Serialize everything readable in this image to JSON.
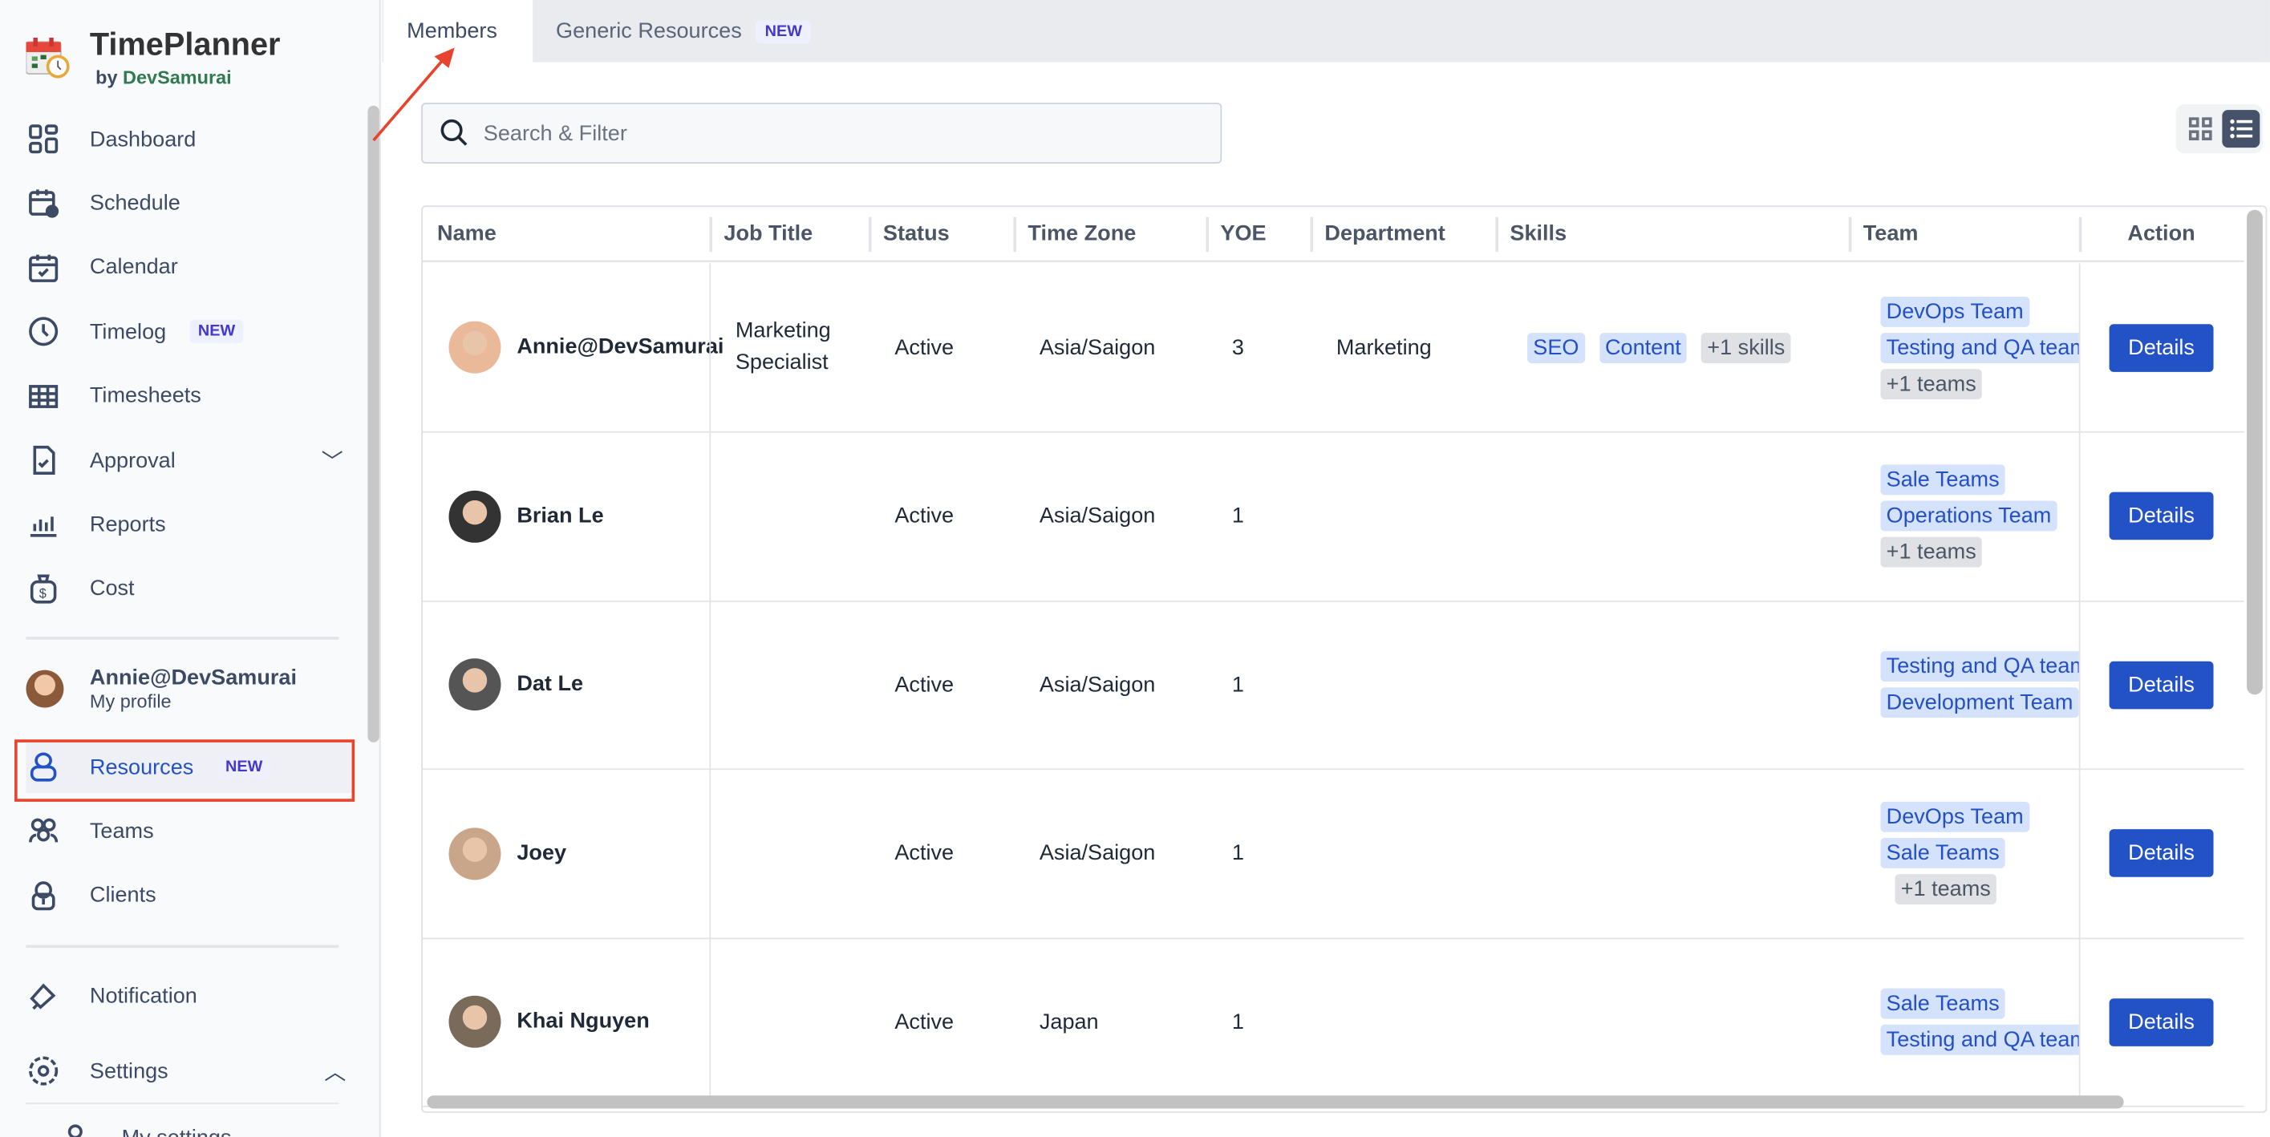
{
  "app": {
    "title": "TimePlanner",
    "by": "by",
    "company": "DevSamurai"
  },
  "sidebar": {
    "items": [
      {
        "label": "Dashboard",
        "icon": "dashboard-icon"
      },
      {
        "label": "Schedule",
        "icon": "schedule-icon"
      },
      {
        "label": "Calendar",
        "icon": "calendar-icon"
      },
      {
        "label": "Timelog",
        "icon": "clock-icon",
        "badge": "NEW"
      },
      {
        "label": "Timesheets",
        "icon": "table-icon"
      },
      {
        "label": "Approval",
        "icon": "approval-icon"
      },
      {
        "label": "Reports",
        "icon": "reports-icon"
      },
      {
        "label": "Cost",
        "icon": "cost-icon"
      }
    ],
    "profile": {
      "name": "Annie@DevSamurai",
      "sub": "My profile"
    },
    "items2": [
      {
        "label": "Resources",
        "icon": "user-icon",
        "badge": "NEW",
        "active": true
      },
      {
        "label": "Teams",
        "icon": "teams-icon"
      },
      {
        "label": "Clients",
        "icon": "clients-icon"
      }
    ],
    "notification": "Notification",
    "settings": "Settings",
    "my_settings": "My settings"
  },
  "tabs": [
    {
      "label": "Members",
      "active": true
    },
    {
      "label": "Generic Resources",
      "badge": "NEW"
    }
  ],
  "search": {
    "placeholder": "Search & Filter"
  },
  "table": {
    "headers": [
      "Name",
      "Job Title",
      "Status",
      "Time Zone",
      "YOE",
      "Department",
      "Skills",
      "Team",
      "Action"
    ],
    "rows": [
      {
        "name": "Annie@DevSamurai",
        "job": "Marketing Specialist",
        "status": "Active",
        "tz": "Asia/Saigon",
        "yoe": "3",
        "dept": "Marketing",
        "skills": [
          "SEO",
          "Content"
        ],
        "skills_more": "+1 skills",
        "teams": [
          "DevOps Team",
          "Testing and QA team"
        ],
        "teams_more": "+1 teams",
        "action": "Details"
      },
      {
        "name": "Brian Le",
        "job": "",
        "status": "Active",
        "tz": "Asia/Saigon",
        "yoe": "1",
        "dept": "",
        "skills": [],
        "teams": [
          "Sale Teams",
          "Operations Team"
        ],
        "teams_more": "+1 teams",
        "action": "Details"
      },
      {
        "name": "Dat Le",
        "job": "",
        "status": "Active",
        "tz": "Asia/Saigon",
        "yoe": "1",
        "dept": "",
        "skills": [],
        "teams": [
          "Testing and QA team",
          "Development Team"
        ],
        "action": "Details"
      },
      {
        "name": "Joey",
        "job": "",
        "status": "Active",
        "tz": "Asia/Saigon",
        "yoe": "1",
        "dept": "",
        "skills": [],
        "teams": [
          "DevOps Team",
          "Sale Teams"
        ],
        "teams_inline_more": "+1 teams",
        "action": "Details"
      },
      {
        "name": "Khai Nguyen",
        "job": "",
        "status": "Active",
        "tz": "Japan",
        "yoe": "1",
        "dept": "",
        "skills": [],
        "teams": [
          "Sale Teams",
          "Testing and QA team"
        ],
        "action": "Details"
      }
    ]
  },
  "colors": {
    "accent": "#2352c6",
    "tag_bg": "#d4e2fc",
    "annotation": "#e8432d"
  }
}
